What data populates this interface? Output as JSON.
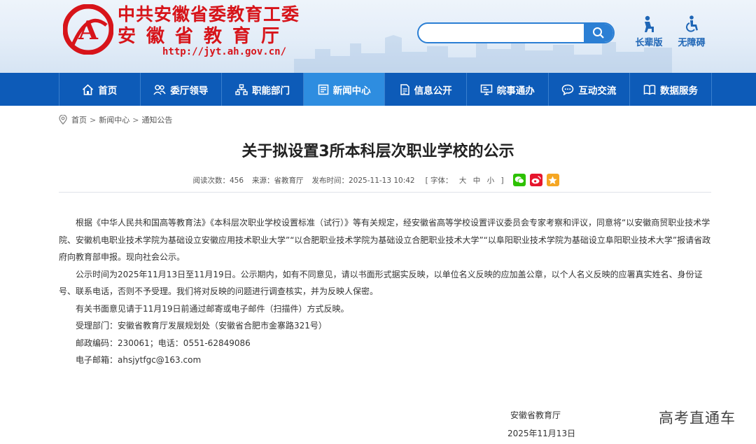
{
  "header": {
    "logo_letter": "A",
    "title_line1": "中共安徽省委教育工委",
    "title_line2": "安徽省教育厅",
    "url": "http://jyt.ah.gov.cn/",
    "search": {
      "placeholder": ""
    },
    "tools": [
      {
        "label": "长辈版",
        "icon": "elder-icon"
      },
      {
        "label": "无障碍",
        "icon": "wheelchair-icon"
      }
    ]
  },
  "nav": {
    "items": [
      {
        "label": "首页",
        "icon": "home-icon"
      },
      {
        "label": "委厅领导",
        "icon": "leaders-icon"
      },
      {
        "label": "职能部门",
        "icon": "departments-icon"
      },
      {
        "label": "新闻中心",
        "icon": "news-icon",
        "active": true
      },
      {
        "label": "信息公开",
        "icon": "info-icon"
      },
      {
        "label": "皖事通办",
        "icon": "service-icon"
      },
      {
        "label": "互动交流",
        "icon": "chat-icon"
      },
      {
        "label": "数据服务",
        "icon": "data-icon"
      }
    ]
  },
  "breadcrumb": [
    "首页",
    "新闻中心",
    "通知公告"
  ],
  "article": {
    "title": "关于拟设置3所本科层次职业学校的公示",
    "meta": {
      "views": "阅读次数：456",
      "source": "来源：省教育厅",
      "published": "发布时间：2025-11-13 10:42",
      "font_open": "[ 字体：",
      "font_large": "大",
      "font_medium": "中",
      "font_small": "小",
      "font_close": "]"
    },
    "share_icons": [
      {
        "name": "wechat-icon",
        "color": "#2dc100"
      },
      {
        "name": "weibo-icon",
        "color": "#e6162d"
      },
      {
        "name": "qzone-icon",
        "color": "#f5a623"
      }
    ],
    "paragraphs": [
      "根据《中华人民共和国高等教育法》《本科层次职业学校设置标准（试行）》等有关规定，经安徽省高等学校设置评议委员会专家考察和评议，同意将“以安徽商贸职业技术学院、安徽机电职业技术学院为基础设立安徽应用技术职业大学”“以合肥职业技术学院为基础设立合肥职业技术大学”“以阜阳职业技术学院为基础设立阜阳职业技术大学”报请省政府向教育部申报。现向社会公示。",
      "公示时间为2025年11月13日至11月19日。公示期内，如有不同意见，请以书面形式据实反映，以单位名义反映的应加盖公章，以个人名义反映的应署真实姓名、身份证号、联系电话，否则不予受理。我们将对反映的问题进行调查核实，并为反映人保密。",
      "有关书面意见请于11月19日前通过邮寄或电子邮件（扫描件）方式反映。",
      "受理部门：安徽省教育厅发展规划处（安徽省合肥市金寨路321号）",
      "邮政编码：230061；电话：0551-62849086",
      "电子邮箱：ahsjytfgc@163.com"
    ],
    "signature": "安徽省教育厅",
    "signature_date": "2025年11月13日"
  },
  "watermark": "高考直通车",
  "colors": {
    "brand_red": "#d7141a",
    "nav_blue": "#0d5bb8",
    "nav_active": "#2e8de0",
    "search_blue": "#2b7fd4"
  }
}
